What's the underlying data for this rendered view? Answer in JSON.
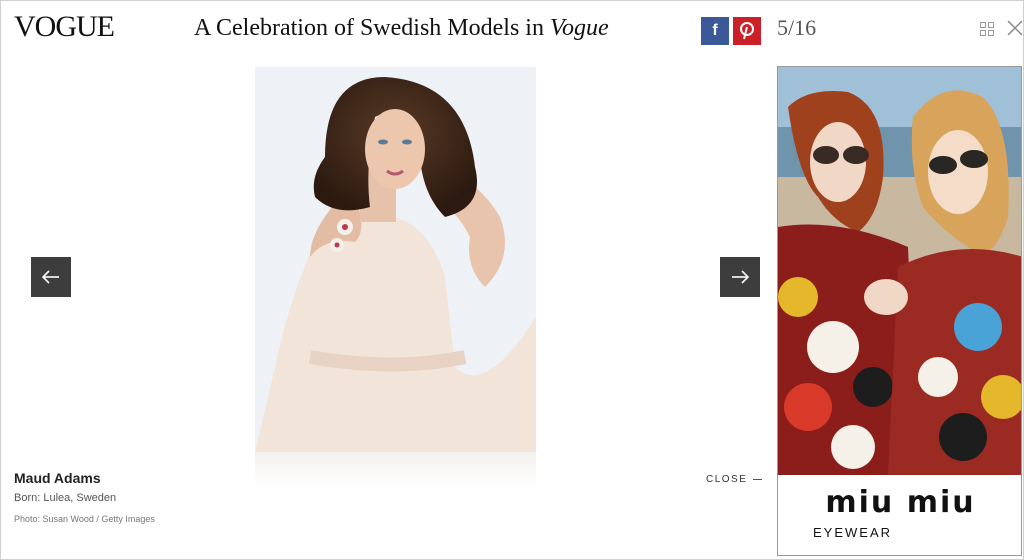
{
  "header": {
    "logo": "VOGUE",
    "title_plain": "A Celebration of Swedish Models in ",
    "title_italic": "Vogue",
    "facebook_glyph": "f",
    "pinterest_glyph": "P",
    "counter": "5/16",
    "icons": [
      "grid-view-icon",
      "close-icon"
    ]
  },
  "slide": {
    "name": "Maud Adams",
    "born": "Born: Lulea, Sweden",
    "credit": "Photo: Susan Wood / Getty Images",
    "close_label": "CLOSE"
  },
  "navigation": {
    "prev_icon": "arrow-left-icon",
    "next_icon": "arrow-right-icon"
  },
  "ad": {
    "brand": "miu miu",
    "subline": "EYEWEAR"
  },
  "colors": {
    "facebook": "#3b5998",
    "pinterest": "#cb2027",
    "arrow_bg": "#3d3d3d"
  }
}
